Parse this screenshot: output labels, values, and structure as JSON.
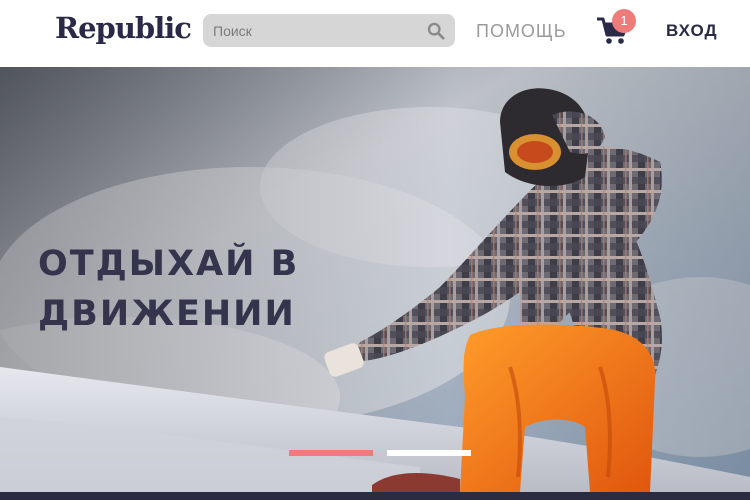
{
  "header": {
    "logo": "Republic",
    "search": {
      "placeholder": "Поиск",
      "icon": "search-icon"
    },
    "nav": {
      "help": "ПОМОЩЬ",
      "login": "ВХОД"
    },
    "cart": {
      "icon": "cart-icon",
      "count": "1"
    }
  },
  "hero": {
    "title": "ОТДЫХАЙ В ДВИЖЕНИИ",
    "slides": [
      {
        "active": true,
        "color": "#f07b7b"
      },
      {
        "active": false,
        "color": "#ffffff"
      }
    ]
  },
  "colors": {
    "brand": "#2a2a48",
    "accent": "#f07b7b",
    "search_bg": "#d6d6d6",
    "help_text": "#9a9a9a"
  }
}
